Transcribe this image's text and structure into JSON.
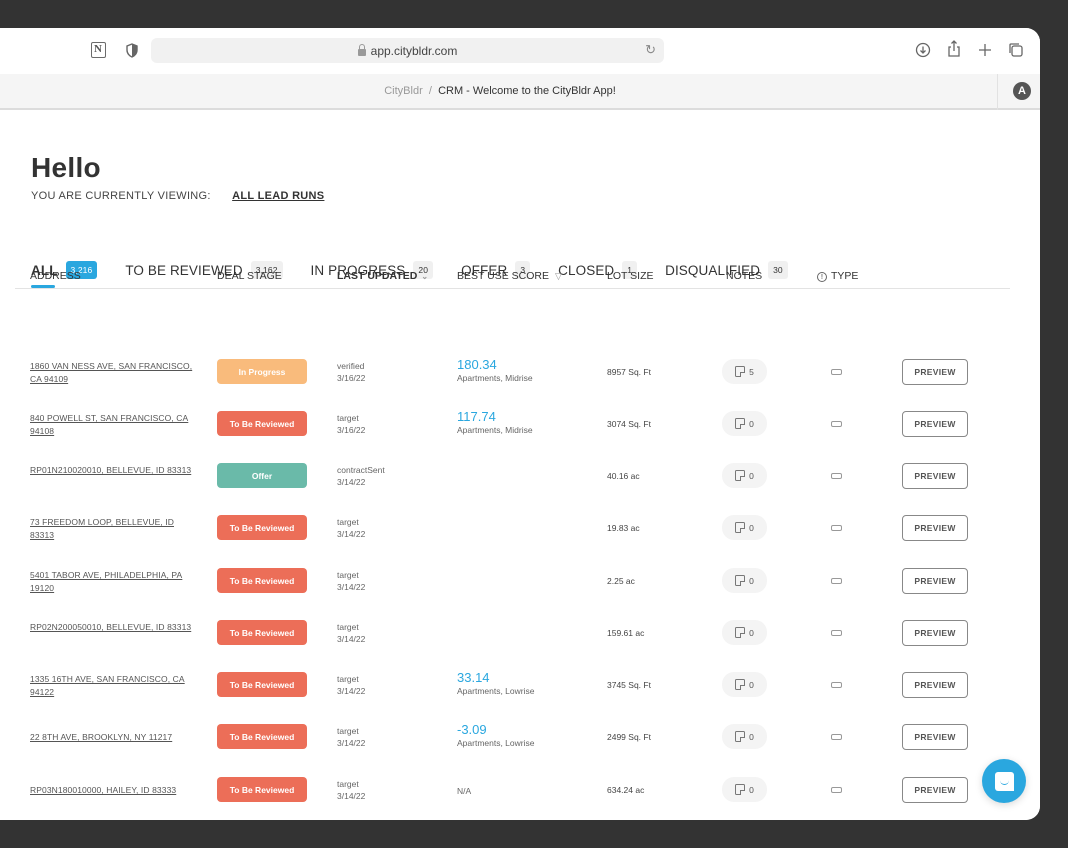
{
  "browser": {
    "url": "app.citybldr.com",
    "icons": [
      "notion-icon",
      "shield-icon",
      "lock-icon",
      "reload-icon",
      "download-icon",
      "share-icon",
      "new-tab-icon",
      "tabs-overview-icon"
    ]
  },
  "tabbar": {
    "breadcrumb_root": "CityBldr",
    "breadcrumb_separator": "/",
    "breadcrumb_current": "CRM - Welcome to the CityBldr App!",
    "avatar_letter": "A"
  },
  "page": {
    "greeting": "Hello",
    "viewing_label": "YOU ARE CURRENTLY VIEWING:",
    "viewing_link": "ALL LEAD RUNS"
  },
  "filters": [
    {
      "label": "ALL",
      "count": "3,216",
      "active": true
    },
    {
      "label": "TO BE REVIEWED",
      "count": "3,162",
      "active": false
    },
    {
      "label": "IN PROGRESS",
      "count": "20",
      "active": false
    },
    {
      "label": "OFFER",
      "count": "3",
      "active": false
    },
    {
      "label": "CLOSED",
      "count": "1",
      "active": false
    },
    {
      "label": "DISQUALIFIED",
      "count": "30",
      "active": false
    }
  ],
  "table": {
    "columns": {
      "address": "ADDRESS",
      "deal_stage": "DEAL STAGE",
      "last_updated": "LAST UPDATED",
      "best_use_score": "BEST USE SCORE",
      "lot_size": "LOT SIZE",
      "notes": "NOTES",
      "type": "TYPE"
    },
    "preview_label": "PREVIEW",
    "stage_colors": {
      "In Progress": "#f9bb7c",
      "To Be Reviewed": "#ec6e58",
      "Offer": "#6abaa9"
    },
    "rows": [
      {
        "address": "1860 VAN NESS AVE, SAN FRANCISCO, CA 94109",
        "stage": "In Progress",
        "status": "verified",
        "date": "3/16/22",
        "score": "180.34",
        "use": "Apartments, Midrise",
        "lot": "8957 Sq. Ft",
        "notes": "5"
      },
      {
        "address": "840 POWELL ST, SAN FRANCISCO, CA 94108",
        "stage": "To Be Reviewed",
        "status": "target",
        "date": "3/16/22",
        "score": "117.74",
        "use": "Apartments, Midrise",
        "lot": "3074 Sq. Ft",
        "notes": "0"
      },
      {
        "address": "RP01N210020010, BELLEVUE, ID 83313",
        "stage": "Offer",
        "status": "contractSent",
        "date": "3/14/22",
        "score": "",
        "use": "",
        "lot": "40.16 ac",
        "notes": "0"
      },
      {
        "address": "73 FREEDOM LOOP, BELLEVUE, ID 83313",
        "stage": "To Be Reviewed",
        "status": "target",
        "date": "3/14/22",
        "score": "",
        "use": "",
        "lot": "19.83 ac",
        "notes": "0"
      },
      {
        "address": "5401 TABOR AVE, PHILADELPHIA, PA 19120",
        "stage": "To Be Reviewed",
        "status": "target",
        "date": "3/14/22",
        "score": "",
        "use": "",
        "lot": "2.25 ac",
        "notes": "0"
      },
      {
        "address": "RP02N200050010, BELLEVUE, ID 83313",
        "stage": "To Be Reviewed",
        "status": "target",
        "date": "3/14/22",
        "score": "",
        "use": "",
        "lot": "159.61 ac",
        "notes": "0"
      },
      {
        "address": "1335 16TH AVE, SAN FRANCISCO, CA 94122",
        "stage": "To Be Reviewed",
        "status": "target",
        "date": "3/14/22",
        "score": "33.14",
        "use": "Apartments, Lowrise",
        "lot": "3745 Sq. Ft",
        "notes": "0"
      },
      {
        "address": "22 8TH AVE, BROOKLYN, NY 11217",
        "stage": "To Be Reviewed",
        "status": "target",
        "date": "3/14/22",
        "score": "-3.09",
        "use": "Apartments, Lowrise",
        "lot": "2499 Sq. Ft",
        "notes": "0"
      },
      {
        "address": "RP03N180010000, HAILEY, ID 83333",
        "stage": "To Be Reviewed",
        "status": "target",
        "date": "3/14/22",
        "score_na": "N/A",
        "score": "",
        "use": "",
        "lot": "634.24 ac",
        "notes": "0"
      }
    ]
  },
  "colors": {
    "accent": "#2aa7df",
    "in_progress": "#f9bb7c",
    "to_be_reviewed": "#ec6e58",
    "offer": "#6abaa9"
  }
}
